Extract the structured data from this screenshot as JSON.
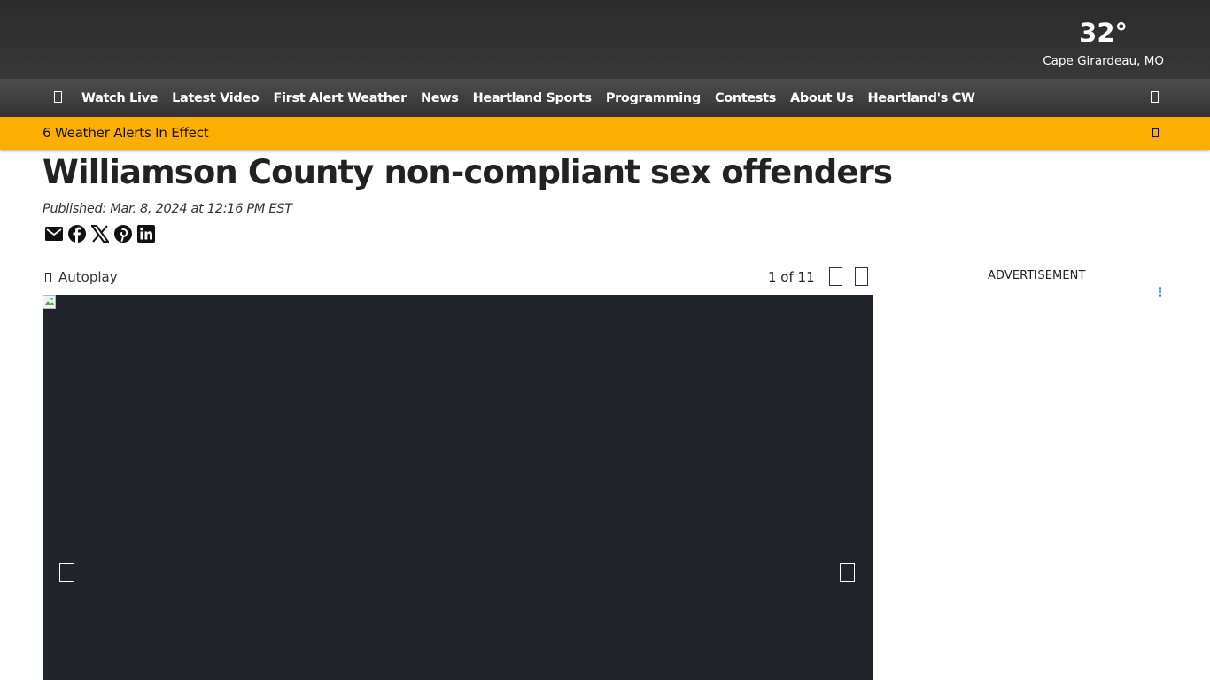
{
  "header": {
    "weather": {
      "temperature": "32°",
      "location": "Cape Girardeau, MO"
    }
  },
  "nav": {
    "menu_icon": "hamburger-icon",
    "search_icon": "search-icon",
    "items": [
      {
        "label": "Watch Live"
      },
      {
        "label": "Latest Video"
      },
      {
        "label": "First Alert Weather"
      },
      {
        "label": "News"
      },
      {
        "label": "Heartland Sports"
      },
      {
        "label": "Programming"
      },
      {
        "label": "Contests"
      },
      {
        "label": "About Us"
      },
      {
        "label": "Heartland's CW"
      }
    ]
  },
  "alert": {
    "text": "6 Weather Alerts In Effect",
    "icon": "chevron-down-icon",
    "color": "#fdaf00"
  },
  "article": {
    "headline": "Williamson County non-compliant sex offenders",
    "published": "Published: Mar. 8, 2024 at 12:16 PM EST",
    "share": [
      "email-icon",
      "facebook-icon",
      "x-icon",
      "pinterest-icon",
      "linkedin-icon"
    ]
  },
  "gallery": {
    "autoplay_label": "Autoplay",
    "counter": "1 of 11",
    "background_color": "#21242b"
  },
  "sidebar": {
    "ad_label": "ADVERTISEMENT",
    "ad_menu_color": "#2a8fc9"
  }
}
